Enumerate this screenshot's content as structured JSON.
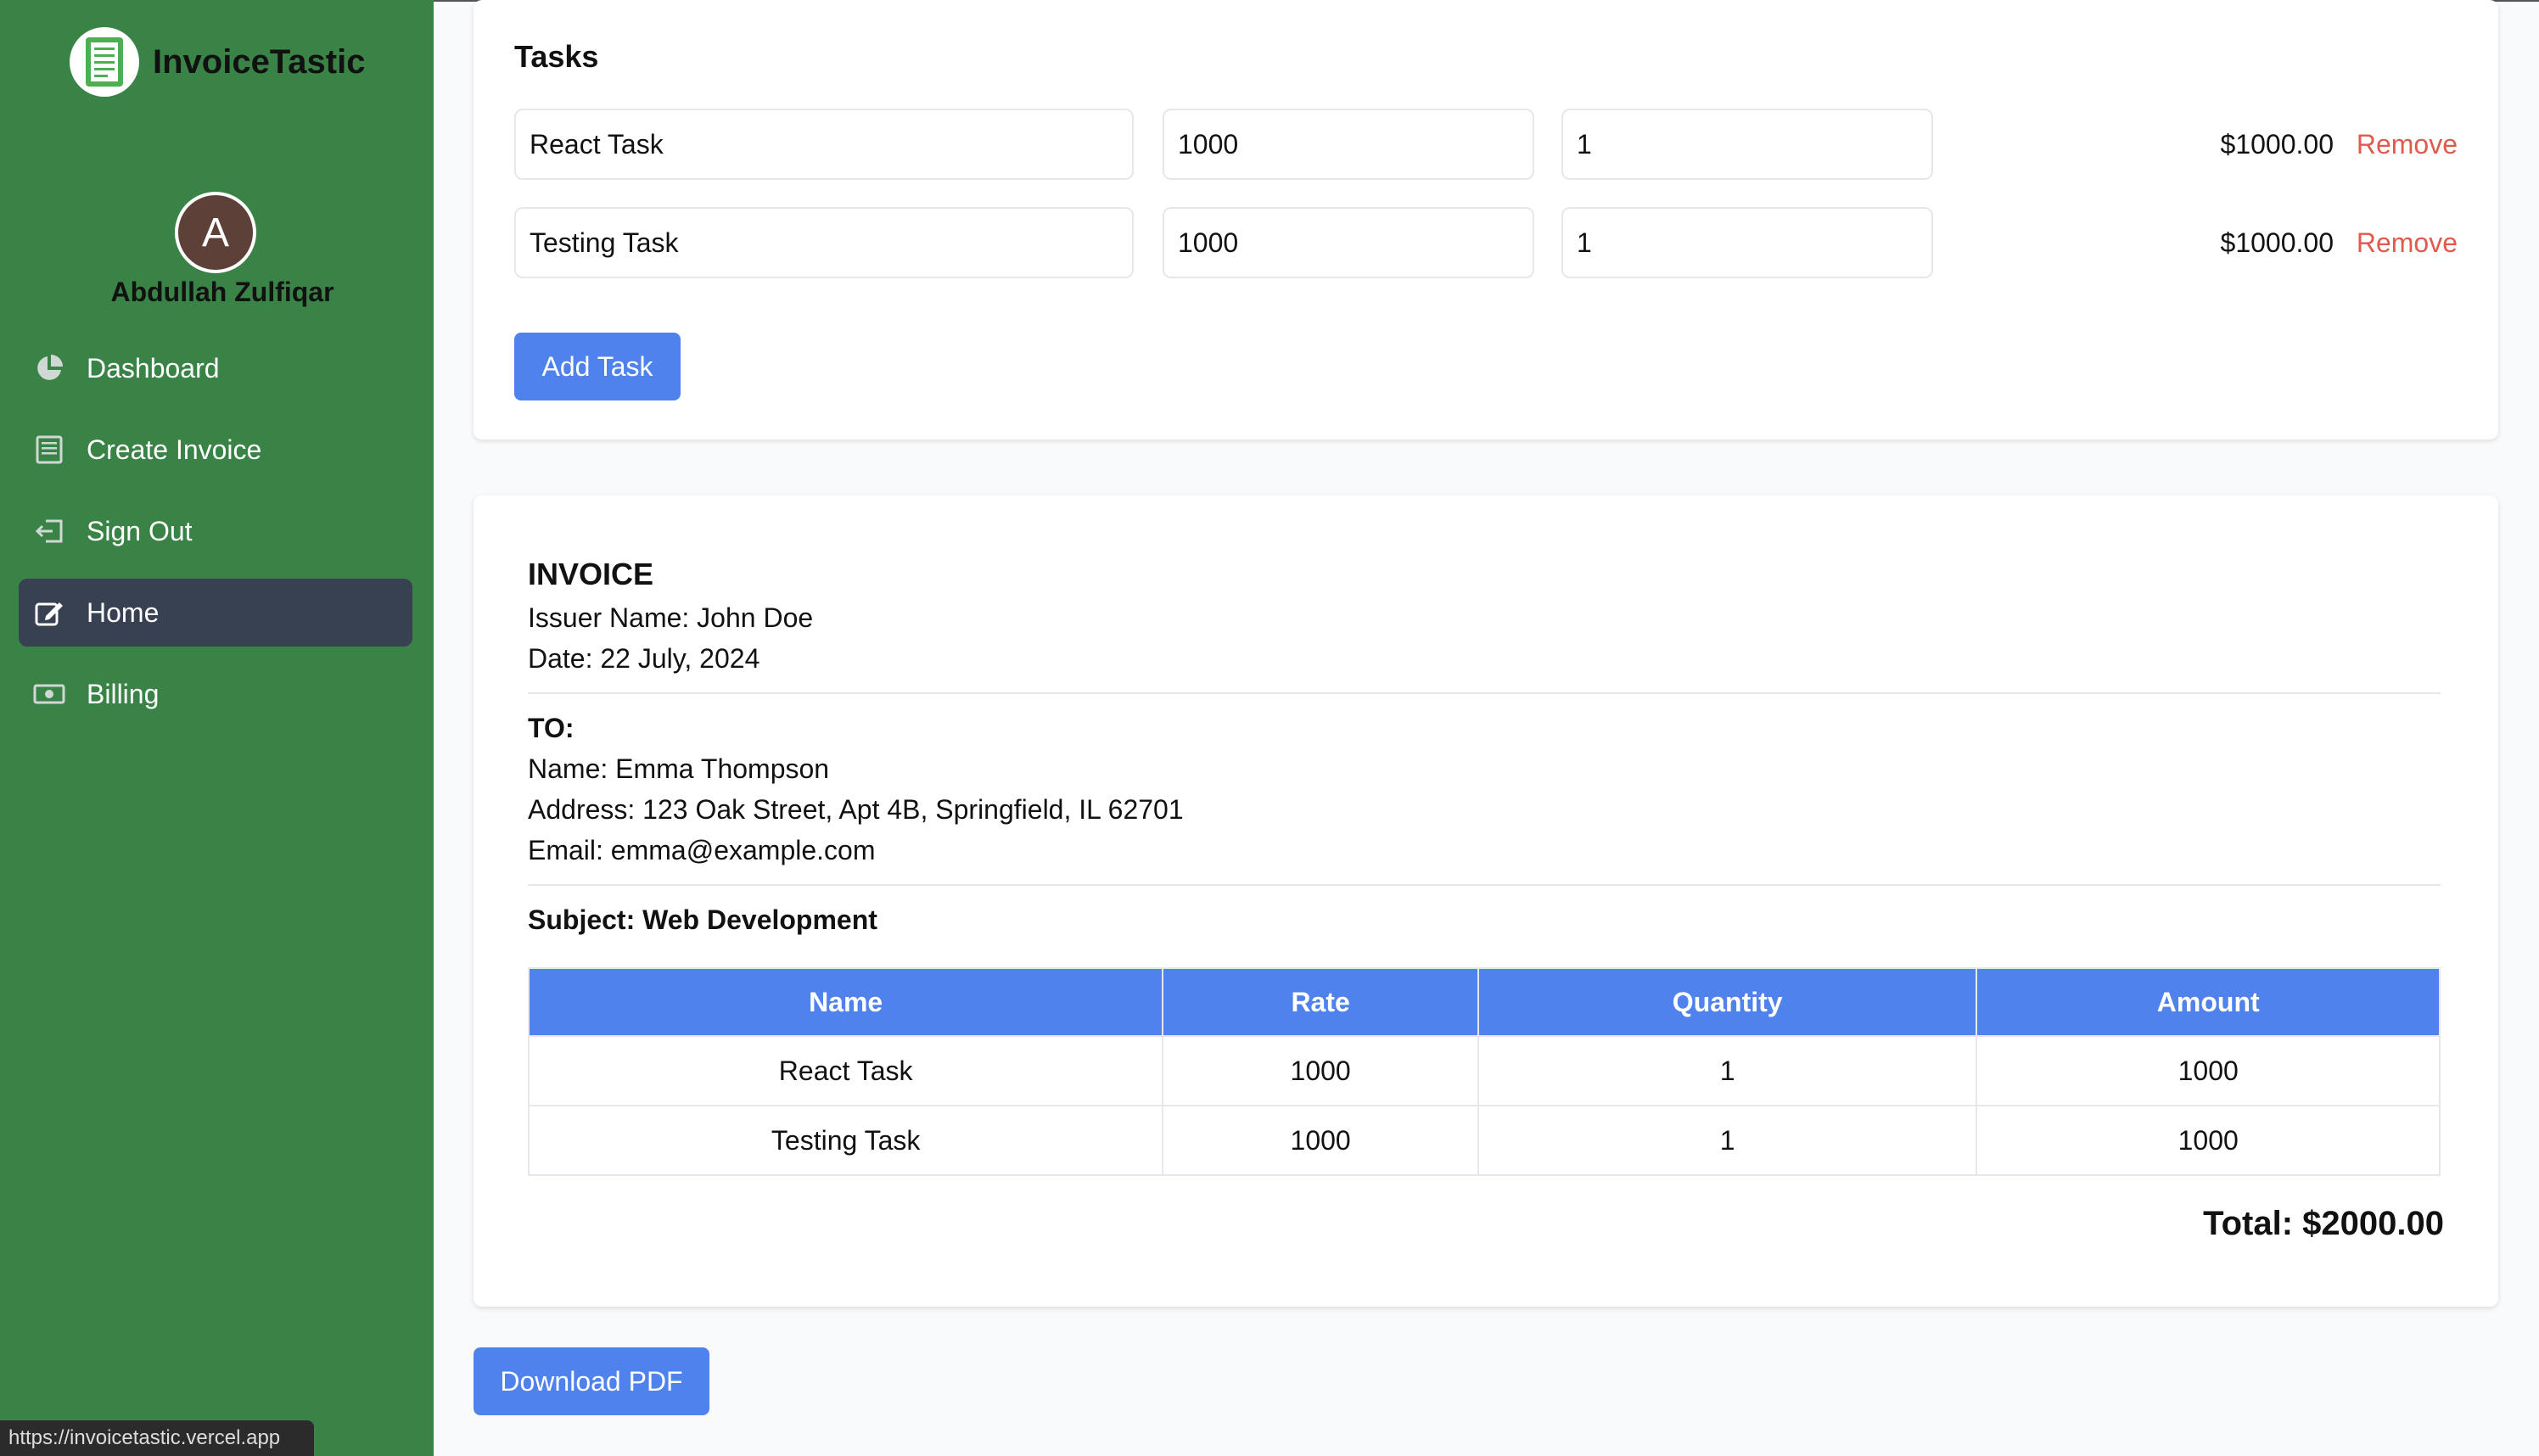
{
  "app": {
    "brand": "InvoiceTastic",
    "logo_icon": "invoice-logo-icon"
  },
  "user": {
    "initial": "A",
    "name": "Abdullah Zulfiqar"
  },
  "sidebar": {
    "items": [
      {
        "label": "Dashboard",
        "icon": "pie-chart-icon"
      },
      {
        "label": "Create Invoice",
        "icon": "document-icon"
      },
      {
        "label": "Sign Out",
        "icon": "sign-out-icon"
      },
      {
        "label": "Home",
        "icon": "edit-icon",
        "active": true
      },
      {
        "label": "Billing",
        "icon": "money-icon"
      }
    ]
  },
  "tasks": {
    "title": "Tasks",
    "rows": [
      {
        "name": "React Task",
        "rate": "1000",
        "quantity": "1",
        "amount": "$1000.00",
        "remove": "Remove"
      },
      {
        "name": "Testing Task",
        "rate": "1000",
        "quantity": "1",
        "amount": "$1000.00",
        "remove": "Remove"
      }
    ],
    "add_label": "Add Task"
  },
  "invoice": {
    "title": "INVOICE",
    "issuer": "Issuer Name: John Doe",
    "date": "Date: 22 July, 2024",
    "to_label": "TO:",
    "to_name": "Name: Emma Thompson",
    "to_address": "Address: 123 Oak Street, Apt 4B, Springfield, IL 62701",
    "to_email": "Email: emma@example.com",
    "subject": "Subject: Web Development",
    "table": {
      "headers": [
        "Name",
        "Rate",
        "Quantity",
        "Amount"
      ],
      "rows": [
        [
          "React Task",
          "1000",
          "1",
          "1000"
        ],
        [
          "Testing Task",
          "1000",
          "1",
          "1000"
        ]
      ]
    },
    "total": "Total: $2000.00"
  },
  "actions": {
    "download_label": "Download PDF"
  },
  "status_bar": {
    "url": "https://invoicetastic.vercel.app"
  },
  "colors": {
    "sidebar": "#3a8346",
    "accent": "#4f82ec",
    "danger": "#e05a4f",
    "active_nav": "#374151"
  }
}
